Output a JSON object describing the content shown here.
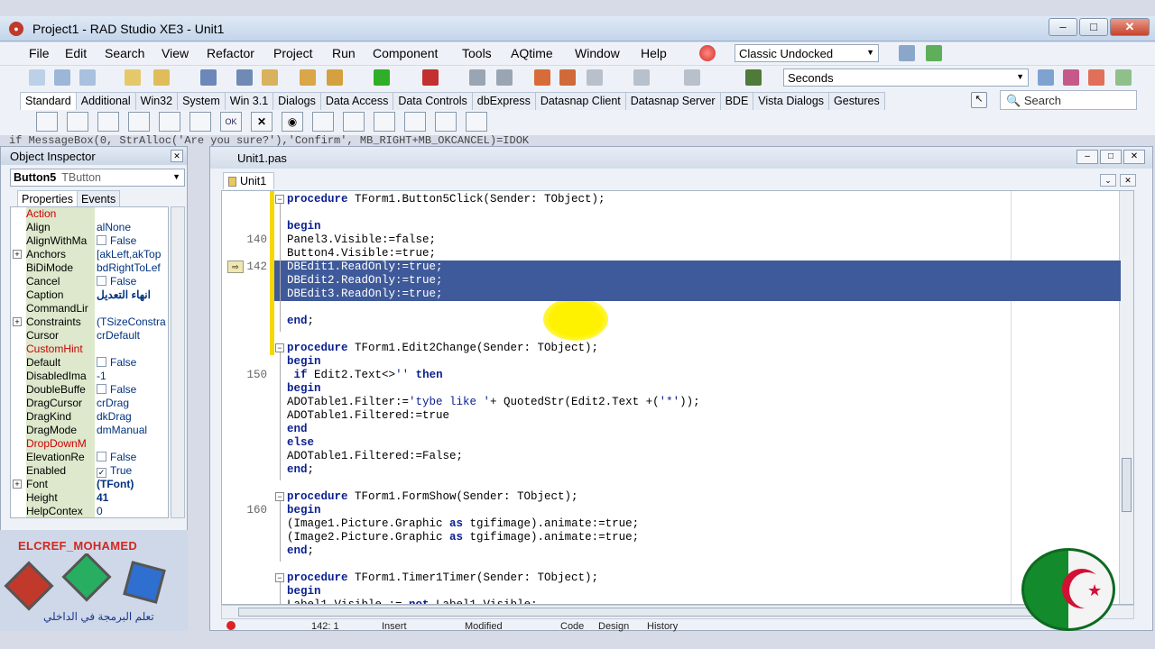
{
  "window": {
    "title": "Project1 - RAD Studio XE3 - Unit1"
  },
  "menu": [
    "File",
    "Edit",
    "Search",
    "View",
    "Refactor",
    "Project",
    "Run",
    "Component",
    "Tools",
    "AQtime",
    "Window",
    "Help"
  ],
  "layout_combo": "Classic Undocked",
  "units_combo": "Seconds",
  "palette_tabs": [
    "Standard",
    "Additional",
    "Win32",
    "System",
    "Win 3.1",
    "Dialogs",
    "Data Access",
    "Data Controls",
    "dbExpress",
    "Datasnap Client",
    "Datasnap Server",
    "BDE",
    "Vista Dialogs",
    "Gestures"
  ],
  "palette_search": "Search",
  "background_code": "if MessageBox(0, StrAlloc('Are you sure?'),'Confirm', MB_RIGHT+MB_OKCANCEL)=IDOK",
  "object_inspector": {
    "title": "Object Inspector",
    "component": "Button5",
    "component_type": "TButton",
    "tabs": [
      "Properties",
      "Events"
    ],
    "properties": [
      {
        "name": "Action",
        "value": "",
        "red": true
      },
      {
        "name": "Align",
        "value": "alNone"
      },
      {
        "name": "AlignWithMa",
        "value": "False",
        "check": "off"
      },
      {
        "name": "Anchors",
        "value": "[akLeft,akTop",
        "expand": true
      },
      {
        "name": "BiDiMode",
        "value": "bdRightToLef"
      },
      {
        "name": "Cancel",
        "value": "False",
        "check": "off"
      },
      {
        "name": "Caption",
        "value": "انهاء التعديل",
        "bold": true
      },
      {
        "name": "CommandLir",
        "value": ""
      },
      {
        "name": "Constraints",
        "value": "(TSizeConstra",
        "expand": true
      },
      {
        "name": "Cursor",
        "value": "crDefault"
      },
      {
        "name": "CustomHint",
        "value": "",
        "red": true
      },
      {
        "name": "Default",
        "value": "False",
        "check": "off"
      },
      {
        "name": "DisabledIma",
        "value": "-1"
      },
      {
        "name": "DoubleBuffe",
        "value": "False",
        "check": "off"
      },
      {
        "name": "DragCursor",
        "value": "crDrag"
      },
      {
        "name": "DragKind",
        "value": "dkDrag"
      },
      {
        "name": "DragMode",
        "value": "dmManual"
      },
      {
        "name": "DropDownM",
        "value": "",
        "red": true
      },
      {
        "name": "ElevationRe",
        "value": "False",
        "check": "off"
      },
      {
        "name": "Enabled",
        "value": "True",
        "check": "on"
      },
      {
        "name": "Font",
        "value": "(TFont)",
        "expand": true,
        "bold": true
      },
      {
        "name": "Height",
        "value": "41",
        "bold": true
      },
      {
        "name": "HelpContex",
        "value": "0"
      }
    ]
  },
  "branding": {
    "name": "ELCREF_MOHAMED",
    "subtitle": "تعلم البرمجة في الداخلي"
  },
  "editor": {
    "window_title": "Unit1.pas",
    "tab": "Unit1",
    "lines": [
      {
        "n": "",
        "t": "procedure TForm1.Button5Click(Sender: TObject);",
        "fold": true
      },
      {
        "n": "",
        "t": ""
      },
      {
        "n": "",
        "t": "begin"
      },
      {
        "n": "140",
        "t": "Panel3.Visible:=false;"
      },
      {
        "n": "",
        "t": "Button4.Visible:=true;"
      },
      {
        "n": "142",
        "t": "DBEdit1.ReadOnly:=true;",
        "sel": true
      },
      {
        "n": "",
        "t": "DBEdit2.ReadOnly:=true;",
        "sel": true
      },
      {
        "n": "",
        "t": "DBEdit3.ReadOnly:=true;",
        "sel": true
      },
      {
        "n": "",
        "t": ""
      },
      {
        "n": "",
        "t": "end;"
      },
      {
        "n": "",
        "t": ""
      },
      {
        "n": "",
        "t": "procedure TForm1.Edit2Change(Sender: TObject);",
        "fold": true
      },
      {
        "n": "",
        "t": "begin"
      },
      {
        "n": "150",
        "t": " if Edit2.Text<>'' then"
      },
      {
        "n": "",
        "t": "begin"
      },
      {
        "n": "",
        "t": "ADOTable1.Filter:='tybe like '+ QuotedStr(Edit2.Text +('*'));"
      },
      {
        "n": "",
        "t": "ADOTable1.Filtered:=true"
      },
      {
        "n": "",
        "t": "end"
      },
      {
        "n": "",
        "t": "else"
      },
      {
        "n": "",
        "t": "ADOTable1.Filtered:=False;"
      },
      {
        "n": "",
        "t": "end;"
      },
      {
        "n": "",
        "t": ""
      },
      {
        "n": "",
        "t": "procedure TForm1.FormShow(Sender: TObject);",
        "fold": true
      },
      {
        "n": "160",
        "t": "begin"
      },
      {
        "n": "",
        "t": "(Image1.Picture.Graphic as tgifimage).animate:=true;"
      },
      {
        "n": "",
        "t": "(Image2.Picture.Graphic as tgifimage).animate:=true;"
      },
      {
        "n": "",
        "t": "end;"
      },
      {
        "n": "",
        "t": ""
      },
      {
        "n": "",
        "t": "procedure TForm1.Timer1Timer(Sender: TObject);",
        "fold": true
      },
      {
        "n": "",
        "t": "begin"
      },
      {
        "n": "",
        "t": "Label1.Visible := not Label1.Visible;"
      }
    ],
    "status": {
      "position": "142: 1",
      "mode": "Insert",
      "state": "Modified",
      "tabs": [
        "Code",
        "Design",
        "History"
      ]
    }
  }
}
